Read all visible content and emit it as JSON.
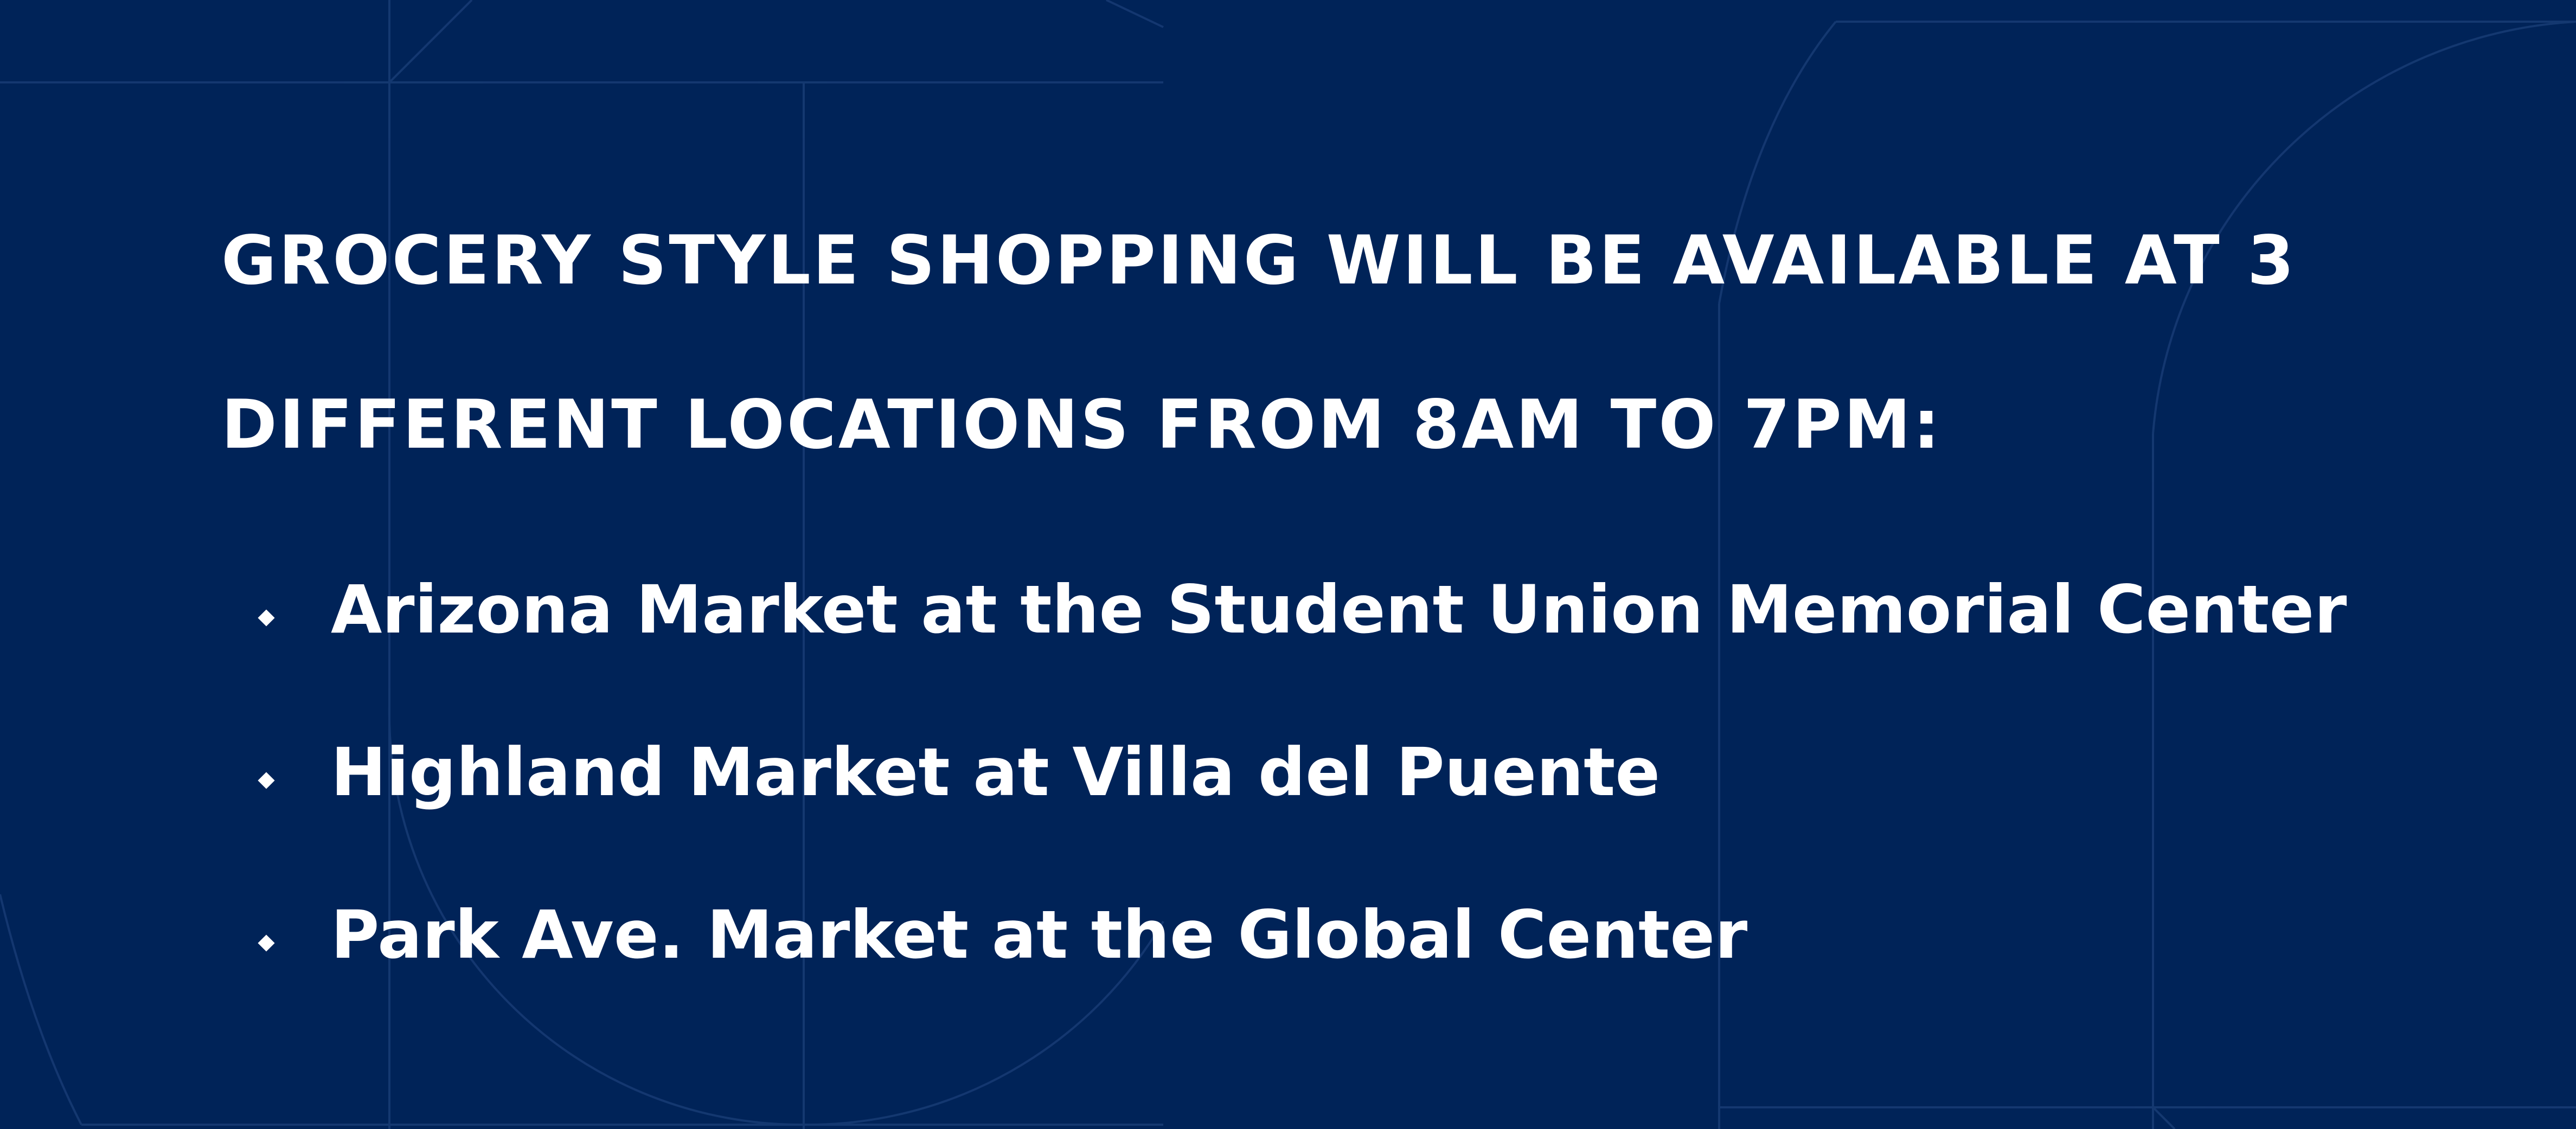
{
  "heading": {
    "line1": "GROCERY STYLE SHOPPING WILL BE AVAILABLE AT 3",
    "line2": "DIFFERENT LOCATIONS FROM 8AM TO 7PM:"
  },
  "locations": [
    {
      "label": "Arizona Market at the Student Union Memorial Center"
    },
    {
      "label": "Highland Market at Villa del Puente"
    },
    {
      "label": "Park Ave. Market at the Global Center"
    }
  ],
  "colors": {
    "background": "#002358",
    "text": "#ffffff",
    "pattern_lines": "#1b3f78"
  },
  "icons": {
    "bullet": "diamond-bullet-icon"
  }
}
